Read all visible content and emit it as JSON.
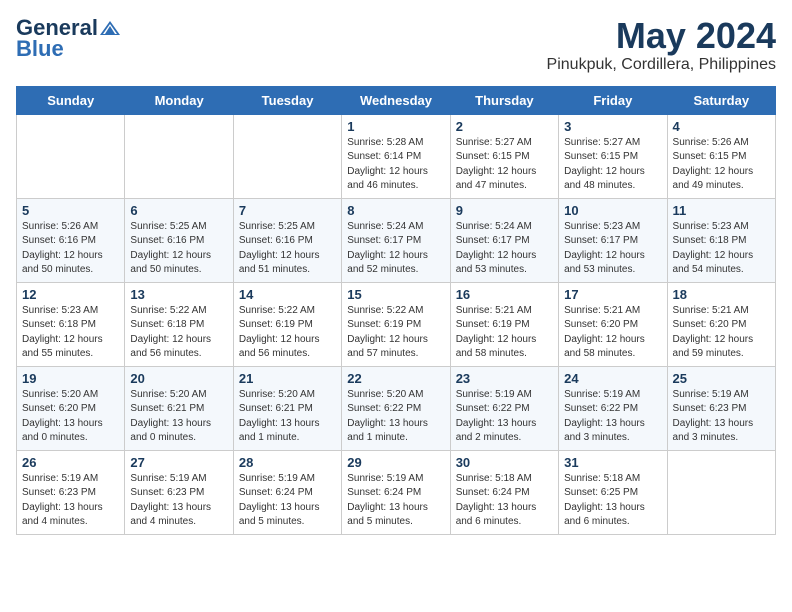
{
  "header": {
    "logo_line1": "General",
    "logo_line2": "Blue",
    "month": "May 2024",
    "location": "Pinukpuk, Cordillera, Philippines"
  },
  "days_of_week": [
    "Sunday",
    "Monday",
    "Tuesday",
    "Wednesday",
    "Thursday",
    "Friday",
    "Saturday"
  ],
  "weeks": [
    [
      {
        "day": "",
        "info": ""
      },
      {
        "day": "",
        "info": ""
      },
      {
        "day": "",
        "info": ""
      },
      {
        "day": "1",
        "info": "Sunrise: 5:28 AM\nSunset: 6:14 PM\nDaylight: 12 hours\nand 46 minutes."
      },
      {
        "day": "2",
        "info": "Sunrise: 5:27 AM\nSunset: 6:15 PM\nDaylight: 12 hours\nand 47 minutes."
      },
      {
        "day": "3",
        "info": "Sunrise: 5:27 AM\nSunset: 6:15 PM\nDaylight: 12 hours\nand 48 minutes."
      },
      {
        "day": "4",
        "info": "Sunrise: 5:26 AM\nSunset: 6:15 PM\nDaylight: 12 hours\nand 49 minutes."
      }
    ],
    [
      {
        "day": "5",
        "info": "Sunrise: 5:26 AM\nSunset: 6:16 PM\nDaylight: 12 hours\nand 50 minutes."
      },
      {
        "day": "6",
        "info": "Sunrise: 5:25 AM\nSunset: 6:16 PM\nDaylight: 12 hours\nand 50 minutes."
      },
      {
        "day": "7",
        "info": "Sunrise: 5:25 AM\nSunset: 6:16 PM\nDaylight: 12 hours\nand 51 minutes."
      },
      {
        "day": "8",
        "info": "Sunrise: 5:24 AM\nSunset: 6:17 PM\nDaylight: 12 hours\nand 52 minutes."
      },
      {
        "day": "9",
        "info": "Sunrise: 5:24 AM\nSunset: 6:17 PM\nDaylight: 12 hours\nand 53 minutes."
      },
      {
        "day": "10",
        "info": "Sunrise: 5:23 AM\nSunset: 6:17 PM\nDaylight: 12 hours\nand 53 minutes."
      },
      {
        "day": "11",
        "info": "Sunrise: 5:23 AM\nSunset: 6:18 PM\nDaylight: 12 hours\nand 54 minutes."
      }
    ],
    [
      {
        "day": "12",
        "info": "Sunrise: 5:23 AM\nSunset: 6:18 PM\nDaylight: 12 hours\nand 55 minutes."
      },
      {
        "day": "13",
        "info": "Sunrise: 5:22 AM\nSunset: 6:18 PM\nDaylight: 12 hours\nand 56 minutes."
      },
      {
        "day": "14",
        "info": "Sunrise: 5:22 AM\nSunset: 6:19 PM\nDaylight: 12 hours\nand 56 minutes."
      },
      {
        "day": "15",
        "info": "Sunrise: 5:22 AM\nSunset: 6:19 PM\nDaylight: 12 hours\nand 57 minutes."
      },
      {
        "day": "16",
        "info": "Sunrise: 5:21 AM\nSunset: 6:19 PM\nDaylight: 12 hours\nand 58 minutes."
      },
      {
        "day": "17",
        "info": "Sunrise: 5:21 AM\nSunset: 6:20 PM\nDaylight: 12 hours\nand 58 minutes."
      },
      {
        "day": "18",
        "info": "Sunrise: 5:21 AM\nSunset: 6:20 PM\nDaylight: 12 hours\nand 59 minutes."
      }
    ],
    [
      {
        "day": "19",
        "info": "Sunrise: 5:20 AM\nSunset: 6:20 PM\nDaylight: 13 hours\nand 0 minutes."
      },
      {
        "day": "20",
        "info": "Sunrise: 5:20 AM\nSunset: 6:21 PM\nDaylight: 13 hours\nand 0 minutes."
      },
      {
        "day": "21",
        "info": "Sunrise: 5:20 AM\nSunset: 6:21 PM\nDaylight: 13 hours\nand 1 minute."
      },
      {
        "day": "22",
        "info": "Sunrise: 5:20 AM\nSunset: 6:22 PM\nDaylight: 13 hours\nand 1 minute."
      },
      {
        "day": "23",
        "info": "Sunrise: 5:19 AM\nSunset: 6:22 PM\nDaylight: 13 hours\nand 2 minutes."
      },
      {
        "day": "24",
        "info": "Sunrise: 5:19 AM\nSunset: 6:22 PM\nDaylight: 13 hours\nand 3 minutes."
      },
      {
        "day": "25",
        "info": "Sunrise: 5:19 AM\nSunset: 6:23 PM\nDaylight: 13 hours\nand 3 minutes."
      }
    ],
    [
      {
        "day": "26",
        "info": "Sunrise: 5:19 AM\nSunset: 6:23 PM\nDaylight: 13 hours\nand 4 minutes."
      },
      {
        "day": "27",
        "info": "Sunrise: 5:19 AM\nSunset: 6:23 PM\nDaylight: 13 hours\nand 4 minutes."
      },
      {
        "day": "28",
        "info": "Sunrise: 5:19 AM\nSunset: 6:24 PM\nDaylight: 13 hours\nand 5 minutes."
      },
      {
        "day": "29",
        "info": "Sunrise: 5:19 AM\nSunset: 6:24 PM\nDaylight: 13 hours\nand 5 minutes."
      },
      {
        "day": "30",
        "info": "Sunrise: 5:18 AM\nSunset: 6:24 PM\nDaylight: 13 hours\nand 6 minutes."
      },
      {
        "day": "31",
        "info": "Sunrise: 5:18 AM\nSunset: 6:25 PM\nDaylight: 13 hours\nand 6 minutes."
      },
      {
        "day": "",
        "info": ""
      }
    ]
  ]
}
